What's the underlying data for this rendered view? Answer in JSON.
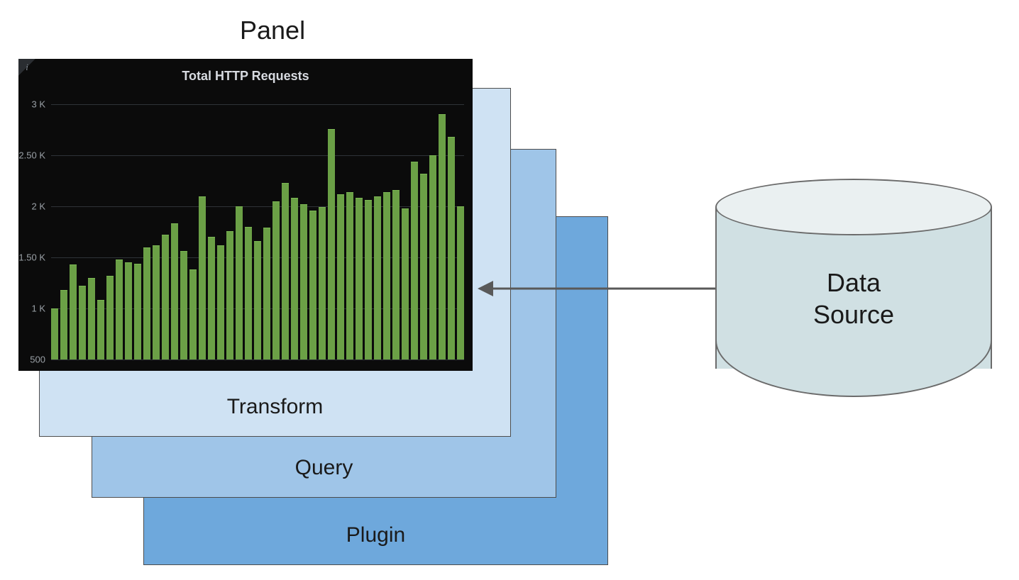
{
  "diagram": {
    "panel_label": "Panel",
    "layers": {
      "plugin": "Plugin",
      "query": "Query",
      "transform": "Transform"
    },
    "data_source_label": "Data\nSource"
  },
  "chart_data": {
    "type": "bar",
    "title": "Total HTTP Requests",
    "xlabel": "",
    "ylabel": "",
    "ylim": [
      500,
      3000
    ],
    "y_ticks": [
      {
        "value": 500,
        "label": "500"
      },
      {
        "value": 1000,
        "label": "1 K"
      },
      {
        "value": 1500,
        "label": "1.50 K"
      },
      {
        "value": 2000,
        "label": "2 K"
      },
      {
        "value": 2500,
        "label": "2.50 K"
      },
      {
        "value": 3000,
        "label": "3 K"
      }
    ],
    "values": [
      1000,
      1180,
      1430,
      1220,
      1300,
      1080,
      1320,
      1480,
      1450,
      1440,
      1600,
      1620,
      1720,
      1830,
      1560,
      1380,
      2100,
      1700,
      1620,
      1760,
      2000,
      1800,
      1660,
      1790,
      2050,
      2230,
      2080,
      2020,
      1960,
      1990,
      2760,
      2120,
      2140,
      2080,
      2060,
      2100,
      2140,
      2160,
      1980,
      2440,
      2320,
      2500,
      2900,
      2680,
      2000
    ]
  }
}
